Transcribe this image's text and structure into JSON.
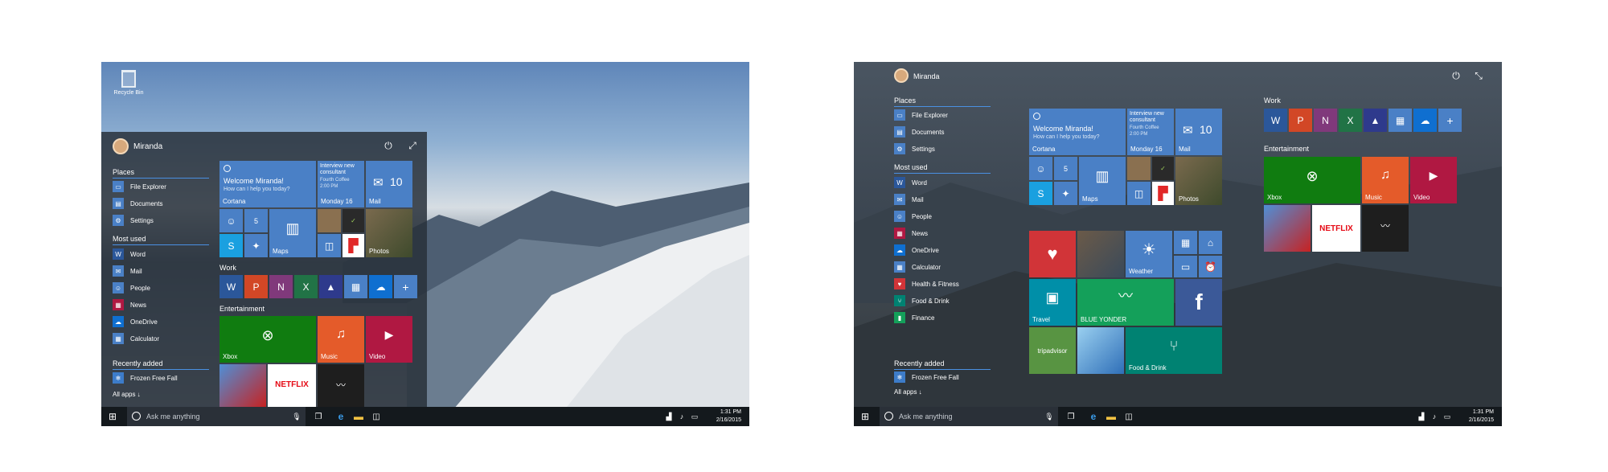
{
  "left": {
    "desktop": {
      "recycle_bin": "Recycle Bin"
    },
    "start": {
      "user": "Miranda",
      "places_heading": "Places",
      "places": [
        "File Explorer",
        "Documents",
        "Settings"
      ],
      "most_used_heading": "Most used",
      "most_used": [
        "Word",
        "Mail",
        "People",
        "News",
        "OneDrive",
        "Calculator"
      ],
      "recently_added_heading": "Recently added",
      "recently_added": [
        "Frozen Free Fall"
      ],
      "all_apps": "All apps ↓",
      "cortana_title": "Welcome Miranda!",
      "cortana_sub": "How can I help you today?",
      "cortana_label": "Cortana",
      "calendar_title": "Interview new consultant",
      "calendar_place": "Fourth Coffee",
      "calendar_time": "2:00 PM",
      "calendar_date": "Monday 16",
      "mail_count": "10",
      "mail_label": "Mail",
      "people_count": "5",
      "maps_label": "Maps",
      "photos_label": "Photos",
      "work_heading": "Work",
      "entertainment_heading": "Entertainment",
      "xbox_label": "Xbox",
      "music_label": "Music",
      "video_label": "Video",
      "netflix": "NETFLIX"
    },
    "taskbar": {
      "search_placeholder": "Ask me anything",
      "time": "1:31 PM",
      "date": "2/16/2015"
    }
  },
  "right": {
    "start": {
      "user": "Miranda",
      "places_heading": "Places",
      "places": [
        "File Explorer",
        "Documents",
        "Settings"
      ],
      "most_used_heading": "Most used",
      "most_used": [
        "Word",
        "Mail",
        "People",
        "News",
        "OneDrive",
        "Calculator",
        "Health & Fitness",
        "Food & Drink",
        "Finance"
      ],
      "recently_added_heading": "Recently added",
      "recently_added": [
        "Frozen Free Fall"
      ],
      "all_apps": "All apps ↓",
      "cortana_title": "Welcome Miranda!",
      "cortana_sub": "How can I help you today?",
      "cortana_label": "Cortana",
      "calendar_title": "Interview new consultant",
      "calendar_place": "Fourth Coffee",
      "calendar_time": "2:00 PM",
      "calendar_date": "Monday 16",
      "mail_count": "10",
      "mail_label": "Mail",
      "people_count": "5",
      "maps_label": "Maps",
      "photos_label": "Photos",
      "weather_label": "Weather",
      "travel_label": "Travel",
      "money_label": "BLUE YONDER",
      "food_label": "Food & Drink",
      "tripadvisor": "tripadvisor",
      "work_heading": "Work",
      "entertainment_heading": "Entertainment",
      "xbox_label": "Xbox",
      "music_label": "Music",
      "video_label": "Video",
      "netflix": "NETFLIX"
    },
    "taskbar": {
      "search_placeholder": "Ask me anything",
      "time": "1:31 PM",
      "date": "2/16/2015"
    }
  },
  "colors": {
    "tile_blue": "#4a80c6",
    "xbox_green": "#107c10",
    "music_orange": "#e45b2a",
    "video_red": "#b01842",
    "health_red": "#d13438",
    "finance_green": "#14a05a",
    "food_teal": "#008272",
    "taskbar": "#14191d",
    "accent_line": "#4a90e2"
  }
}
